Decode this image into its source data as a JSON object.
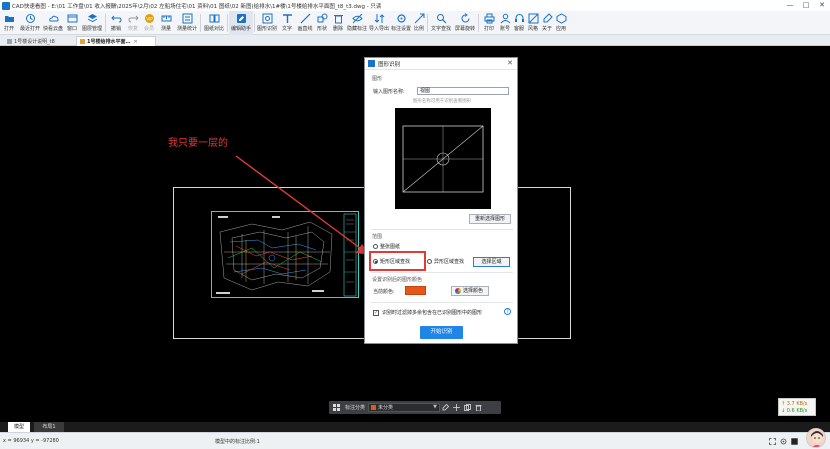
{
  "window": {
    "title": "CAD快速看图 - E:\\01 工作盘\\01 收入报酬\\2025年\\2月\\02 左船场住宅\\01 资料\\01 图纸\\02 新图(给排水\\1#楼\\1号楼给排水平面图_t8_t3.dwg - 只读",
    "controls": [
      "—",
      "□",
      "✕"
    ]
  },
  "toolbar": {
    "items": [
      {
        "label": "打开",
        "icon": "folder-open-icon",
        "color": "#1a73c9"
      },
      {
        "label": "最近打开",
        "icon": "recent-icon",
        "color": "#1a73c9"
      },
      {
        "label": "快看云盘",
        "icon": "cloud-icon",
        "color": "#1a73c9"
      },
      {
        "label": "窗口",
        "icon": "window-icon",
        "color": "#1a73c9"
      },
      {
        "label": "图层管理",
        "icon": "layers-icon",
        "color": "#1a73c9"
      },
      {
        "label": "撤销",
        "icon": "undo-icon",
        "color": "#1a73c9"
      },
      {
        "label": "恢复",
        "icon": "redo-icon",
        "color": "#999999",
        "disabled": true
      },
      {
        "label": "会员",
        "icon": "vip-icon",
        "color": "#e0a000",
        "disabled": true
      },
      {
        "label": "测量",
        "icon": "measure-icon",
        "color": "#1a73c9"
      },
      {
        "label": "测量统计",
        "icon": "measure-stats-icon",
        "color": "#1a73c9"
      },
      {
        "label": "图纸对比",
        "icon": "compare-icon",
        "color": "#1a73c9"
      },
      {
        "label": "编辑助手",
        "icon": "edit-assistant-icon",
        "color": "#1a73c9",
        "active": true
      },
      {
        "label": "图形识别",
        "icon": "shape-recognize-icon",
        "color": "#1a73c9"
      },
      {
        "label": "文字",
        "icon": "text-icon",
        "color": "#1a73c9"
      },
      {
        "label": "画直线",
        "icon": "line-icon",
        "color": "#1a73c9"
      },
      {
        "label": "形状",
        "icon": "shape-icon",
        "color": "#1a73c9"
      },
      {
        "label": "删除",
        "icon": "delete-icon",
        "color": "#1a73c9"
      },
      {
        "label": "隐藏标注",
        "icon": "hide-annotation-icon",
        "color": "#1a73c9"
      },
      {
        "label": "导入导出",
        "icon": "import-export-icon",
        "color": "#1a73c9"
      },
      {
        "label": "标注设置",
        "icon": "annotation-settings-icon",
        "color": "#1a73c9"
      },
      {
        "label": "比例",
        "icon": "scale-icon",
        "color": "#1a73c9"
      },
      {
        "label": "文字查找",
        "icon": "text-search-icon",
        "color": "#1a73c9"
      },
      {
        "label": "屏幕旋转",
        "icon": "rotate-icon",
        "color": "#1a73c9"
      },
      {
        "label": "打印",
        "icon": "print-icon",
        "color": "#1a73c9"
      },
      {
        "label": "账号",
        "icon": "account-icon",
        "color": "#1a73c9"
      },
      {
        "label": "客服",
        "icon": "support-icon",
        "color": "#1a73c9"
      },
      {
        "label": "风格",
        "icon": "style-icon",
        "color": "#1a73c9"
      },
      {
        "label": "关于",
        "icon": "about-icon",
        "color": "#1a73c9"
      },
      {
        "label": "应用",
        "icon": "apps-icon",
        "color": "#1a73c9"
      }
    ]
  },
  "tabs": [
    {
      "label": "1号楼设计说明_t8",
      "close": "✕",
      "active": false
    },
    {
      "label": "1号楼给排水平面…",
      "close": "✕",
      "active": true
    }
  ],
  "canvas": {
    "annotation_text": "我只要一层的",
    "annotation_color": "#e23a3a"
  },
  "canvas_toolbar": {
    "category_label": "标注分类",
    "category_value": "未分类",
    "category_color": "#e8551a"
  },
  "network": {
    "up": "↑ 3.7 KB/s",
    "down": "↓ 0.6 KB/s"
  },
  "layout_tabs": [
    {
      "label": "模型",
      "active": true
    },
    {
      "label": "布局1",
      "active": false
    }
  ],
  "status": {
    "coords": "x = 96934  y = -97280",
    "scale_text": "模型中的标注比例:1"
  },
  "dialog": {
    "title": "图形识别",
    "close": "✕",
    "section_shape": "图形",
    "name_label": "输入图形名称:",
    "name_value": "视图",
    "name_hint": "图形名称可用于识别查看图形",
    "reselect_button": "重新选择图形",
    "section_range": "范围",
    "range_option_full": "整张图纸",
    "range_option_rect": "矩形区域查找",
    "range_option_polygon": "异形区域查找",
    "select_area_button": "选择区域",
    "section_color": "设置识别后的图形颜色",
    "color_label": "当前颜色:",
    "current_color": "#e8551a",
    "color_button": "选择颜色",
    "filter_checkbox_label": "识别时过滤掉多余包含在已识别图形中的图形",
    "help_icon": "?",
    "start_button": "开始识别"
  }
}
